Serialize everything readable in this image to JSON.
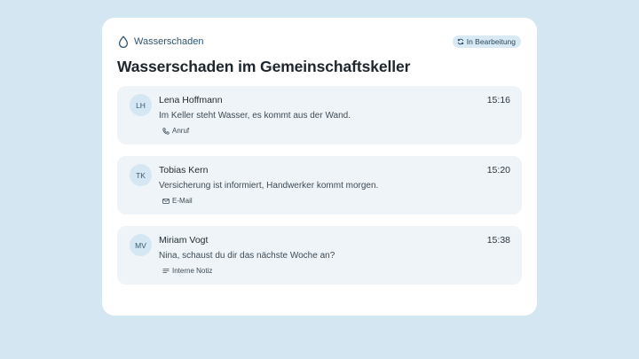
{
  "case": {
    "category_label": "Wasserschaden",
    "category_icon": "water-drop-icon",
    "status_label": "In Bearbeitung",
    "status_icon": "refresh-icon",
    "title": "Wasserschaden im Gemeinschaftskeller"
  },
  "entries": [
    {
      "initials": "LH",
      "name": "Lena Hoffmann",
      "time": "15:16",
      "text": "Im Keller steht Wasser, es kommt aus der Wand.",
      "channel": "Anruf",
      "channel_icon": "phone-icon"
    },
    {
      "initials": "TK",
      "name": "Tobias Kern",
      "time": "15:20",
      "text": "Versicherung ist informiert, Handwerker kommt morgen.",
      "channel": "E-Mail",
      "channel_icon": "mail-icon"
    },
    {
      "initials": "MV",
      "name": "Miriam Vogt",
      "time": "15:38",
      "text": "Nina, schaust du dir das nächste Woche an?",
      "channel": "Interne Notiz",
      "channel_icon": "note-icon"
    }
  ],
  "colors": {
    "background": "#d3e6f1",
    "card": "#ffffff",
    "entry_background": "#eef4f8",
    "avatar_background": "#d4e7f3",
    "accent": "#2f5570"
  }
}
